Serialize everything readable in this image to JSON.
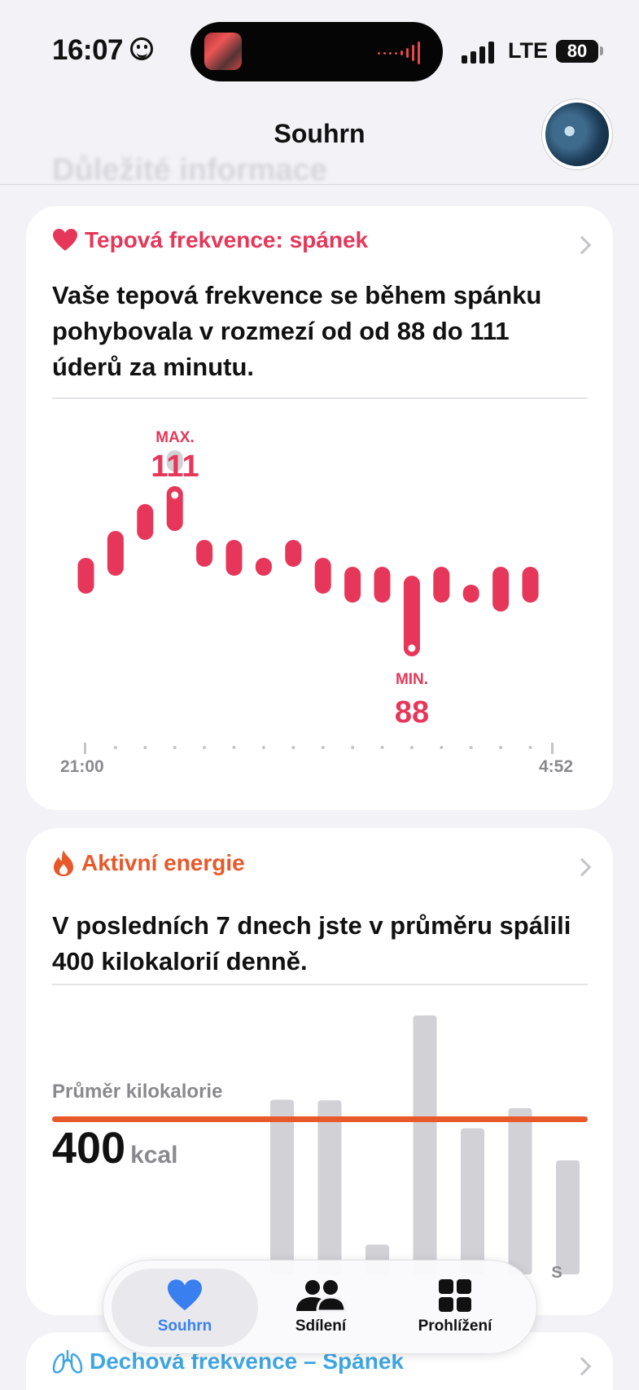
{
  "status_bar": {
    "time": "16:07",
    "network": "LTE",
    "battery": "80"
  },
  "header": {
    "title": "Souhrn",
    "ghost_heading": "Důležité informace"
  },
  "heart_card": {
    "title": "Tepová frekvence: spánek",
    "text": "Vaše tepová frekvence se během spánku pohybovala v rozmezí od od 88 do 111 úderů za minutu.",
    "max_label": "MAX.",
    "max_value": "111",
    "min_label": "MIN.",
    "min_value": "88",
    "x_start": "21:00",
    "x_end": "4:52",
    "accent": "#e6375a"
  },
  "energy_card": {
    "title": "Aktivní energie",
    "text": "V posledních 7 dnech jste v průměru spálili 400 kilokalorií denně.",
    "avg_label": "Průměr kilokalorie",
    "avg_value": "400",
    "avg_unit": "kcal",
    "accent": "#e8592a",
    "visible_day_label": "S"
  },
  "resp_card": {
    "title": "Dechová frekvence – Spánek"
  },
  "tabbar": {
    "tabs": [
      {
        "label": "Souhrn",
        "icon": "heart-icon",
        "active": true
      },
      {
        "label": "Sdílení",
        "icon": "people-icon",
        "active": false
      },
      {
        "label": "Prohlížení",
        "icon": "grid-icon",
        "active": false
      }
    ],
    "active_color": "#3a7ff0"
  },
  "chart_data": [
    {
      "type": "bar",
      "title": "Tepová frekvence: spánek",
      "x_tick_labels": [
        "21:00",
        "4:52"
      ],
      "series": [
        {
          "values_range": [
            [
              95,
              99
            ],
            [
              97,
              102
            ],
            [
              101,
              105
            ],
            [
              102,
              107
            ],
            [
              98,
              101
            ],
            [
              97,
              101
            ],
            [
              97,
              99
            ],
            [
              98,
              101
            ],
            [
              95,
              99
            ],
            [
              94,
              98
            ],
            [
              94,
              98
            ],
            [
              88,
              97
            ],
            [
              94,
              98
            ],
            [
              94,
              96
            ],
            [
              93,
              98
            ],
            [
              94,
              98
            ]
          ]
        }
      ],
      "max": 111,
      "min": 88
    },
    {
      "type": "bar",
      "title": "Aktivní energie",
      "values": [
        470,
        468,
        40,
        720,
        385,
        445,
        290
      ],
      "average": 400
    }
  ]
}
